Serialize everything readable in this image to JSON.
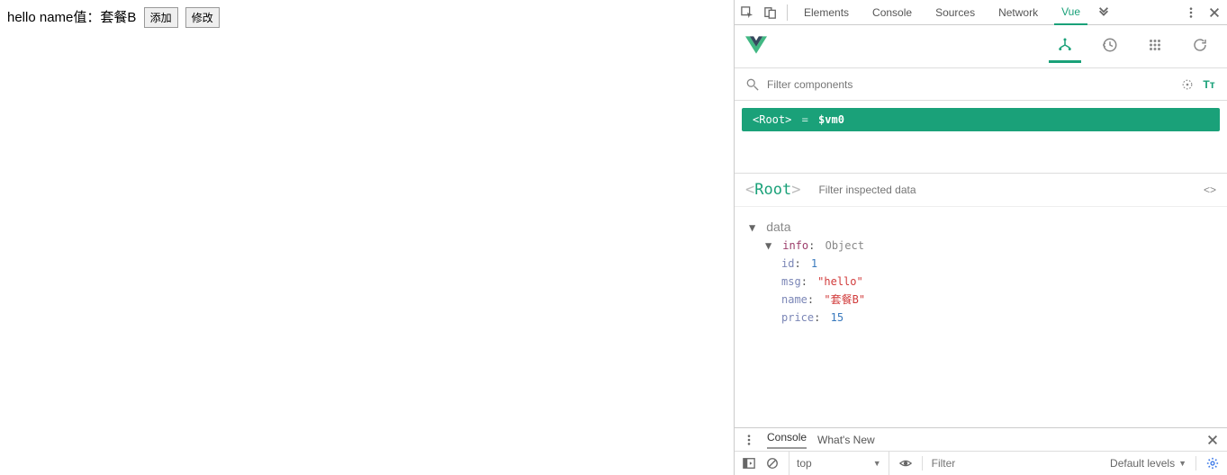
{
  "page": {
    "greeting": "hello",
    "name_label": " name值：",
    "name_value": "套餐B",
    "add_button": "添加",
    "edit_button": "修改"
  },
  "devtools_tabs": {
    "elements": "Elements",
    "console": "Console",
    "sources": "Sources",
    "network": "Network",
    "vue": "Vue"
  },
  "vue_panel": {
    "filter_placeholder": "Filter components",
    "component_tree": {
      "root_label": "<Root>",
      "eq": " = ",
      "vm": "$vm0"
    },
    "details": {
      "root_label_open": "<",
      "root_label_name": "Root",
      "root_label_close": ">",
      "filter_inspected_placeholder": "Filter inspected data",
      "data_heading": "data",
      "info_key": "info",
      "info_type": "Object",
      "props": {
        "id_key": "id",
        "id_val": "1",
        "msg_key": "msg",
        "msg_val": "\"hello\"",
        "name_key": "name",
        "name_val": "\"套餐B\"",
        "price_key": "price",
        "price_val": "15"
      }
    }
  },
  "console_drawer": {
    "tabs": {
      "console": "Console",
      "whats_new": "What's New"
    },
    "toolbar": {
      "context": "top",
      "filter_placeholder": "Filter",
      "levels": "Default levels"
    }
  }
}
